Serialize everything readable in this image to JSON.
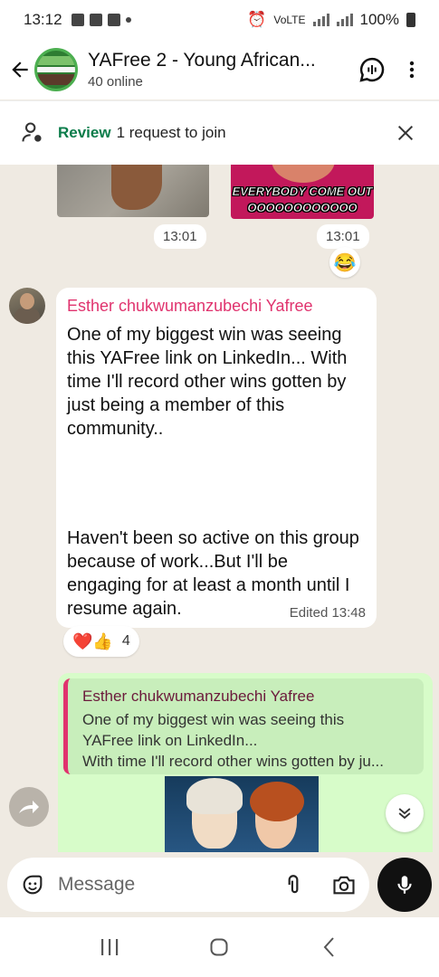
{
  "status_bar": {
    "time": "13:12",
    "battery": "100%",
    "network": "VoLTE"
  },
  "header": {
    "title": "YAFree 2 - Young African...",
    "subtitle": "40 online",
    "icons": {
      "back": "arrow-left-icon",
      "voice_chat": "voice-chat-icon",
      "menu": "more-vertical-icon"
    }
  },
  "review_banner": {
    "action": "Review",
    "text": "1 request to join"
  },
  "chat": {
    "media_caption_line1": "EVERYBODY COME OUT",
    "media_caption_line2": "OOOOOOOOOOOO",
    "media_time_left": "13:01",
    "media_time_right": "13:01",
    "media_reaction": "😂",
    "message": {
      "sender": "Esther chukwumanzubechi Yafree",
      "paragraph1": "One of my biggest win was seeing this YAFree link on LinkedIn... With time I'll record other wins gotten by just being a member of this community..",
      "paragraph2": "Haven't been so active on this group because of work...But I'll be engaging for at least a month until I resume again.",
      "meta": "Edited 13:48",
      "reactions": "❤️👍",
      "reaction_count": "4"
    },
    "reply": {
      "quote_sender": "Esther chukwumanzubechi Yafree",
      "quote_line1": "One of my biggest win was seeing this",
      "quote_line2": "YAFree link on LinkedIn...",
      "quote_line3": "With time I'll record other wins gotten by ju..."
    }
  },
  "composer": {
    "placeholder": "Message"
  },
  "colors": {
    "accent_green": "#0a7c4a",
    "sender_pink": "#e0336e",
    "outgoing_bubble": "#d7fcc9",
    "chat_bg": "#efeae2"
  }
}
